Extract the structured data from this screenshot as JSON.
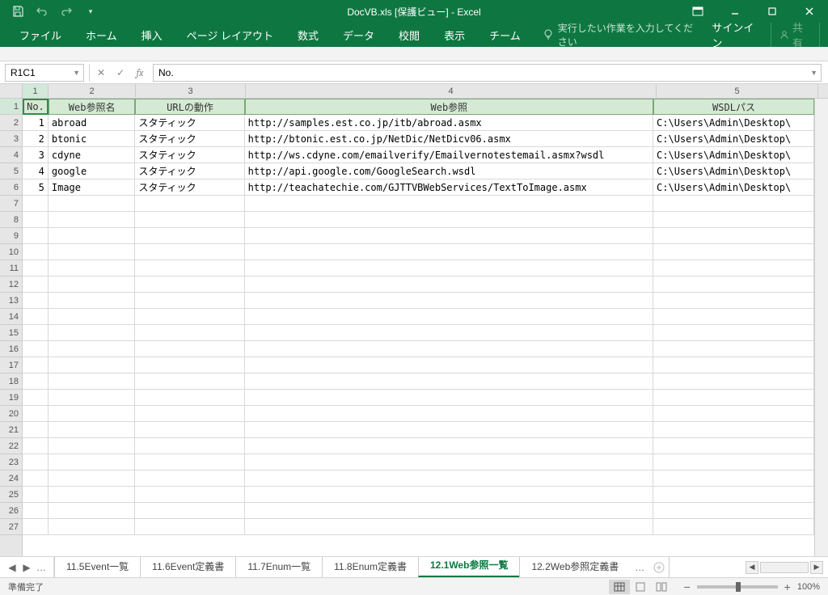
{
  "titlebar": {
    "title": "DocVB.xls  [保護ビュー] - Excel"
  },
  "ribbon": {
    "tabs": [
      "ファイル",
      "ホーム",
      "挿入",
      "ページ レイアウト",
      "数式",
      "データ",
      "校閲",
      "表示",
      "チーム"
    ],
    "tellme": "実行したい作業を入力してください",
    "signin": "サインイン",
    "share": "共有"
  },
  "formulabar": {
    "namebox": "R1C1",
    "formula": "No."
  },
  "grid": {
    "col_headers": [
      "1",
      "2",
      "3",
      "4",
      "5"
    ],
    "row_headers": [
      "1",
      "2",
      "3",
      "4",
      "5",
      "6",
      "7",
      "8",
      "9",
      "10",
      "11",
      "12",
      "13",
      "14",
      "15",
      "16",
      "17",
      "18",
      "19",
      "20",
      "21",
      "22",
      "23",
      "24",
      "25",
      "26",
      "27"
    ],
    "header_row": [
      "No.",
      "Web参照名",
      "URLの動作",
      "Web参照",
      "WSDLパス"
    ],
    "data_rows": [
      [
        "1",
        "abroad",
        "スタティック",
        "http://samples.est.co.jp/itb/abroad.asmx",
        "C:\\Users\\Admin\\Desktop\\"
      ],
      [
        "2",
        "btonic",
        "スタティック",
        "http://btonic.est.co.jp/NetDic/NetDicv06.asmx",
        "C:\\Users\\Admin\\Desktop\\"
      ],
      [
        "3",
        "cdyne",
        "スタティック",
        "http://ws.cdyne.com/emailverify/Emailvernotestemail.asmx?wsdl",
        "C:\\Users\\Admin\\Desktop\\"
      ],
      [
        "4",
        "google",
        "スタティック",
        "http://api.google.com/GoogleSearch.wsdl",
        "C:\\Users\\Admin\\Desktop\\"
      ],
      [
        "5",
        "Image",
        "スタティック",
        "http://teachatechie.com/GJTTVBWebServices/TextToImage.asmx",
        "C:\\Users\\Admin\\Desktop\\"
      ]
    ]
  },
  "sheets": {
    "tabs": [
      "11.5Event一覧",
      "11.6Event定義書",
      "11.7Enum一覧",
      "11.8Enum定義書",
      "12.1Web参照一覧",
      "12.2Web参照定義書"
    ],
    "active_index": 4
  },
  "statusbar": {
    "status": "準備完了",
    "zoom": "100%"
  }
}
